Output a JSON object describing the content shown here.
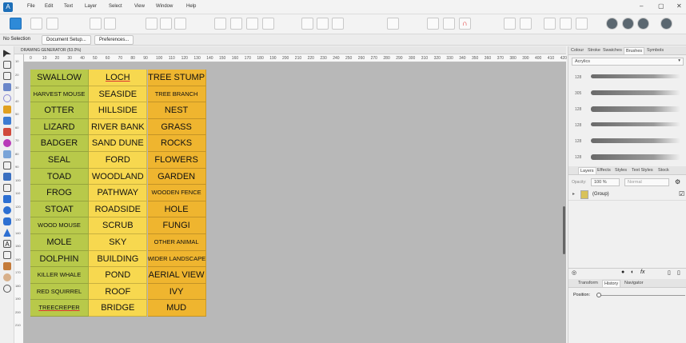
{
  "menu": [
    "File",
    "Edit",
    "Text",
    "Layer",
    "Select",
    "View",
    "Window",
    "Help"
  ],
  "context": {
    "selection": "No Selection",
    "doc_setup": "Document Setup...",
    "preferences": "Preferences..."
  },
  "document": {
    "tab_title": "DRAWING GENERATOR (53.0%)"
  },
  "ruler_labels": [
    "0",
    "10",
    "20",
    "30",
    "40",
    "50",
    "60",
    "70",
    "80",
    "90",
    "100",
    "110",
    "120",
    "130",
    "140",
    "150",
    "160",
    "170",
    "180",
    "190",
    "200",
    "210",
    "220",
    "230",
    "240",
    "250",
    "260",
    "270",
    "280",
    "290",
    "300",
    "310",
    "320",
    "330",
    "340",
    "350",
    "360",
    "370",
    "380",
    "390",
    "400",
    "410",
    "420"
  ],
  "ruler_v_labels": [
    "10",
    "20",
    "30",
    "40",
    "50",
    "60",
    "70",
    "80",
    "90",
    "100",
    "110",
    "120",
    "130",
    "140",
    "150",
    "160",
    "170",
    "180",
    "190",
    "200",
    "210"
  ],
  "columns": [
    {
      "color": "#b8c94a",
      "items": [
        "SWALLOW",
        "HARVEST MOUSE",
        "OTTER",
        "LIZARD",
        "BADGER",
        "SEAL",
        "TOAD",
        "FROG",
        "STOAT",
        "WOOD MOUSE",
        "MOLE",
        "DOLPHIN",
        "KILLER WHALE",
        "RED SQUIRREL",
        "TREECREPER"
      ]
    },
    {
      "color": "#f7d84f",
      "items": [
        "LOCH",
        "SEASIDE",
        "HILLSIDE",
        "RIVER BANK",
        "SAND DUNE",
        "FORD",
        "WOODLAND",
        "PATHWAY",
        "ROADSIDE",
        "SCRUB",
        "SKY",
        "BUILDING",
        "POND",
        "ROOF",
        "BRIDGE"
      ]
    },
    {
      "color": "#efb52f",
      "items": [
        "TREE STUMP",
        "TREE BRANCH",
        "NEST",
        "GRASS",
        "ROCKS",
        "FLOWERS",
        "GARDEN",
        "WOODEN FENCE",
        "HOLE",
        "FUNGI",
        "OTHER ANIMAL",
        "WIDER LANDSCAPE",
        "AERIAL VIEW",
        "IVY",
        "MUD"
      ]
    }
  ],
  "small_labels": [
    "HARVEST MOUSE",
    "WOOD MOUSE",
    "KILLER WHALE",
    "RED SQUIRREL",
    "TREECREPER",
    "TREE BRANCH",
    "WOODEN FENCE",
    "OTHER ANIMAL",
    "WIDER LANDSCAPE"
  ],
  "panel": {
    "top_tabs": [
      "Colour",
      "Stroke",
      "Swatches",
      "Brushes",
      "Symbols"
    ],
    "brush_category": "Acrylics",
    "brush_sizes": [
      "128",
      "305",
      "128",
      "128",
      "128",
      "128"
    ],
    "mid_tabs": [
      "Layers",
      "Effects",
      "Styles",
      "Text Styles",
      "Stock"
    ],
    "opacity_label": "Opacity:",
    "opacity_value": "100 %",
    "blend_mode": "Normal",
    "layer_name": "(Group)",
    "bottom_tabs": [
      "Transform",
      "History",
      "Navigator"
    ],
    "position_label": "Position:"
  }
}
